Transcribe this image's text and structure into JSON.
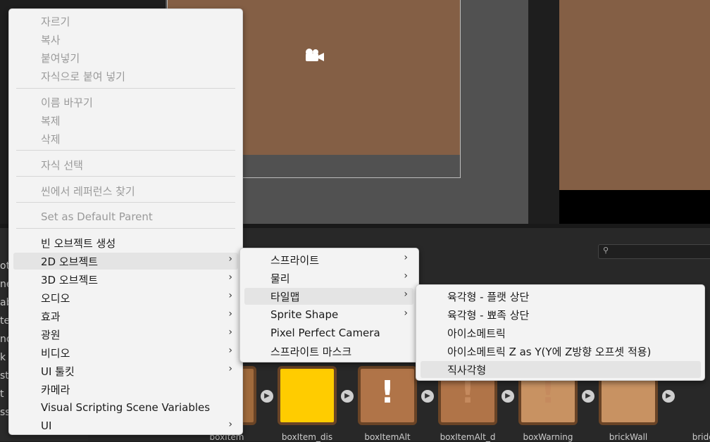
{
  "main_menu": {
    "items": [
      {
        "label": "자르기",
        "disabled": true
      },
      {
        "label": "복사",
        "disabled": true
      },
      {
        "label": "붙여넣기",
        "disabled": true
      },
      {
        "label": "자식으로 붙여 넣기",
        "disabled": true
      },
      {
        "label": "이름 바꾸기",
        "disabled": true
      },
      {
        "label": "복제",
        "disabled": true
      },
      {
        "label": "삭제",
        "disabled": true
      },
      {
        "label": "자식 선택",
        "disabled": true
      },
      {
        "label": "씬에서 레퍼런스 찾기",
        "disabled": true
      },
      {
        "label": "Set as Default Parent",
        "disabled": true
      },
      {
        "label": "빈 오브젝트 생성",
        "disabled": false
      },
      {
        "label": "2D 오브젝트",
        "disabled": false,
        "submenu": true,
        "highlighted": true
      },
      {
        "label": "3D 오브젝트",
        "disabled": false,
        "submenu": true
      },
      {
        "label": "오디오",
        "disabled": false,
        "submenu": true
      },
      {
        "label": "효과",
        "disabled": false,
        "submenu": true
      },
      {
        "label": "광원",
        "disabled": false,
        "submenu": true
      },
      {
        "label": "비디오",
        "disabled": false,
        "submenu": true
      },
      {
        "label": "UI 툴킷",
        "disabled": false,
        "submenu": true
      },
      {
        "label": "카메라",
        "disabled": false
      },
      {
        "label": "Visual Scripting Scene Variables",
        "disabled": false
      },
      {
        "label": "UI",
        "disabled": false,
        "submenu": true
      }
    ]
  },
  "submenu_2d": {
    "items": [
      {
        "label": "스프라이트",
        "submenu": true
      },
      {
        "label": "물리",
        "submenu": true
      },
      {
        "label": "타일맵",
        "submenu": true,
        "highlighted": true
      },
      {
        "label": "Sprite Shape",
        "submenu": true
      },
      {
        "label": "Pixel Perfect Camera"
      },
      {
        "label": "스프라이트 마스크"
      }
    ]
  },
  "submenu_tilemap": {
    "items": [
      {
        "label": "육각형 - 플랫 상단"
      },
      {
        "label": "육각형 - 뾰족 상단"
      },
      {
        "label": "아이소메트릭"
      },
      {
        "label": "아이소메트릭 Z as Y(Y에 Z방향 오프셋 적용)"
      },
      {
        "label": "직사각형",
        "highlighted": true
      }
    ]
  },
  "assets": [
    {
      "name": "boxItem"
    },
    {
      "name": "boxItem_dis"
    },
    {
      "name": "boxItemAlt"
    },
    {
      "name": "boxItemAlt_d"
    },
    {
      "name": "boxWarning"
    },
    {
      "name": "brickWall"
    },
    {
      "name": "bridge"
    }
  ],
  "left_panel_fragments": [
    "ots",
    "ne",
    "ab",
    "te",
    "nd",
    "k",
    "stl",
    "t",
    "ss"
  ],
  "arrow_glyph": "›",
  "icons": {
    "play": "▶",
    "camera": "camera-icon",
    "search": "search-icon",
    "exclaim": "!"
  },
  "colors": {
    "scene_bg": "#845f45",
    "menu_bg": "#f3f3f3",
    "editor_bg": "#282828"
  }
}
